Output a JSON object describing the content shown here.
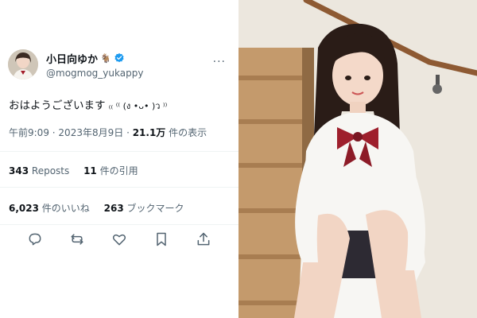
{
  "tweet": {
    "display_name": "小日向ゆか",
    "name_emoji": "🐐",
    "handle": "@mogmog_yukappy",
    "text": "おはようございます",
    "kaomoji": "₍₍ ⁽⁽ (ง •ᴗ• )ว ⁾⁾",
    "time": "午前9:09",
    "date": "2023年8月9日",
    "views_count": "21.1万",
    "views_label": "件の表示",
    "reposts_count": "343",
    "reposts_label": "Reposts",
    "quotes_count": "11",
    "quotes_label": "件の引用",
    "likes_count": "6,023",
    "likes_label": "件のいいね",
    "bookmarks_count": "263",
    "bookmarks_label": "ブックマーク",
    "more_label": "···"
  },
  "icons": [
    "verified-badge-icon",
    "more-icon",
    "reply-icon",
    "repost-icon",
    "like-icon",
    "bookmark-icon",
    "share-icon"
  ],
  "colors": {
    "verified": "#1d9bf0",
    "secondary_text": "#536471",
    "primary_text": "#0f1419",
    "divider": "#eff3f4",
    "photo_wall": "#ede8df",
    "stairs": "#b48a5c"
  }
}
